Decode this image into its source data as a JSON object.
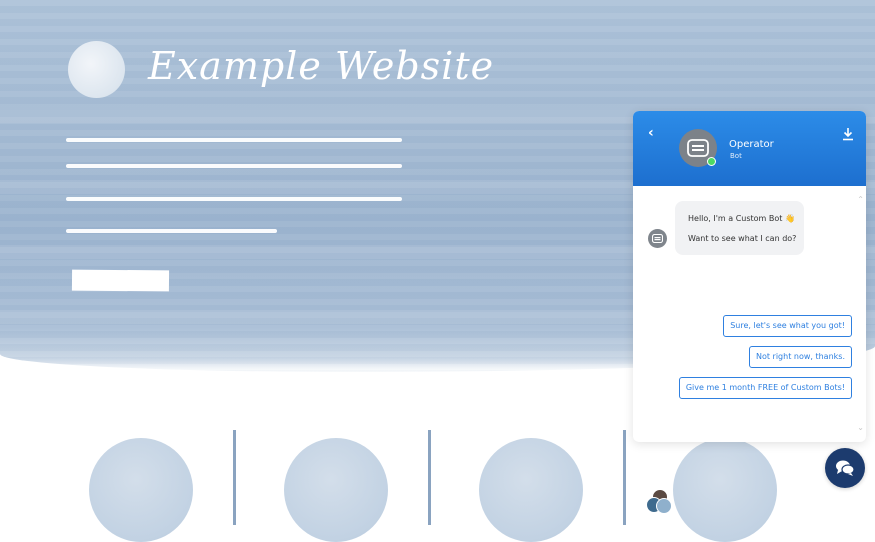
{
  "site": {
    "title": "Example Website"
  },
  "chat": {
    "operator_name": "Operator",
    "operator_role": "Bot",
    "messages": [
      "Hello, I'm a Custom Bot 👋",
      "Want to see what I can do?"
    ],
    "quick_replies": [
      "Sure, let's see what you got!",
      "Not right now, thanks.",
      "Give me 1 month FREE of Custom Bots!"
    ],
    "icons": {
      "back": "chevron-left-icon",
      "download": "download-icon",
      "launcher": "chat-bubbles-icon",
      "bot": "bot-icon"
    },
    "colors": {
      "header": "#1d6fcf",
      "accent": "#2f80e0",
      "launcher": "#1c3b6e",
      "online": "#4cd964"
    }
  }
}
